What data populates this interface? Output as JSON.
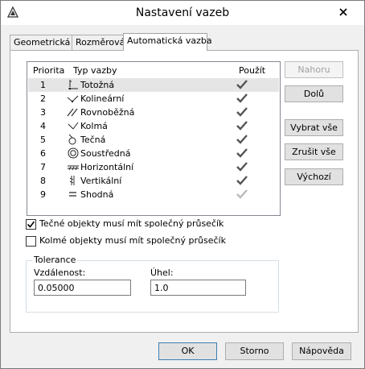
{
  "window": {
    "title": "Nastavení vazeb",
    "close_icon": "close-icon",
    "app_icon": "autocad-triangle-icon"
  },
  "tabs": [
    {
      "label": "Geometrická",
      "active": false
    },
    {
      "label": "Rozměrová",
      "active": false
    },
    {
      "label": "Automatická vazba",
      "active": true
    }
  ],
  "list": {
    "headers": {
      "priority": "Priorita",
      "type": "Typ vazby",
      "use": "Použít"
    },
    "rows": [
      {
        "priority": "1",
        "name": "Totožná",
        "icon": "coincident-icon",
        "checked": true,
        "selected": true
      },
      {
        "priority": "2",
        "name": "Kolineární",
        "icon": "collinear-icon",
        "checked": true
      },
      {
        "priority": "3",
        "name": "Rovnoběžná",
        "icon": "parallel-icon",
        "checked": true
      },
      {
        "priority": "4",
        "name": "Kolmá",
        "icon": "perpendicular-icon",
        "checked": true
      },
      {
        "priority": "5",
        "name": "Tečná",
        "icon": "tangent-icon",
        "checked": true
      },
      {
        "priority": "6",
        "name": "Soustředná",
        "icon": "concentric-icon",
        "checked": true
      },
      {
        "priority": "7",
        "name": "Horizontální",
        "icon": "horizontal-icon",
        "checked": true
      },
      {
        "priority": "8",
        "name": "Vertikální",
        "icon": "vertical-icon",
        "checked": true
      },
      {
        "priority": "9",
        "name": "Shodná",
        "icon": "equal-icon",
        "checked": false
      }
    ]
  },
  "side_buttons": {
    "up": "Nahoru",
    "down": "Dolů",
    "select_all": "Vybrat vše",
    "clear_all": "Zrušit vše",
    "reset": "Výchozí"
  },
  "options": {
    "tangent_label": "Tečné objekty musí mít společný průsečík",
    "tangent_checked": true,
    "perpendicular_label": "Kolmé objekty musí mít společný průsečík",
    "perpendicular_checked": false
  },
  "tolerance": {
    "legend": "Tolerance",
    "distance_label": "Vzdálenost:",
    "distance_value": "0.05000",
    "angle_label": "Úhel:",
    "angle_value": "1.0"
  },
  "footer": {
    "ok": "OK",
    "cancel": "Storno",
    "help": "Nápověda"
  },
  "colors": {
    "check_enabled": "#555555",
    "check_disabled": "#b8b8b8",
    "default_button_border": "#3c7fb1"
  }
}
